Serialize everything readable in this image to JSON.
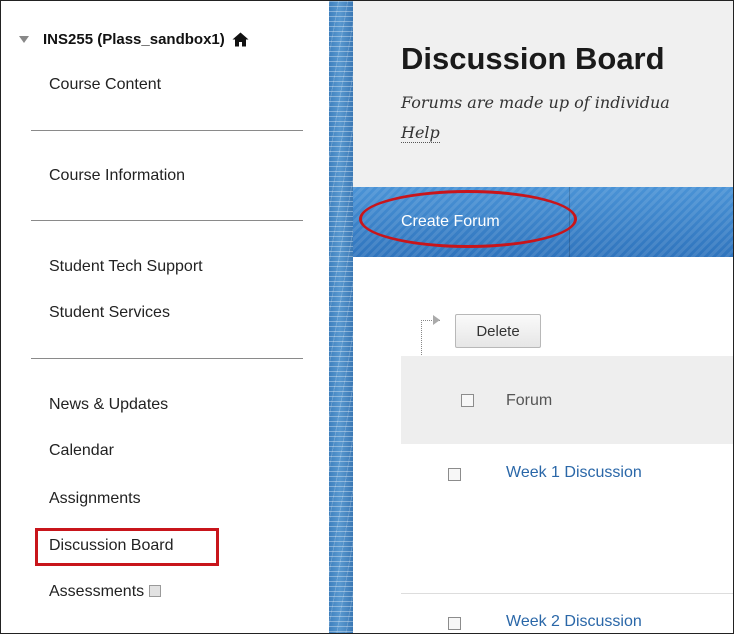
{
  "course": {
    "title": "INS255 (Plass_sandbox1)",
    "home_icon": "home-icon"
  },
  "menu": {
    "course_content": "Course Content",
    "course_information": "Course Information",
    "student_tech_support": "Student Tech Support",
    "student_services": "Student Services",
    "news_updates": "News & Updates",
    "calendar": "Calendar",
    "assignments": "Assignments",
    "discussion_board": "Discussion Board",
    "assessments": "Assessments"
  },
  "page": {
    "title": "Discussion Board",
    "description": "Forums are made up of individua",
    "help": "Help"
  },
  "actionbar": {
    "create_forum": "Create Forum"
  },
  "toolbar": {
    "delete": "Delete"
  },
  "table": {
    "header_forum": "Forum",
    "rows": [
      {
        "title": "Week 1 Discussion"
      },
      {
        "title": "Week 2 Discussion"
      }
    ]
  },
  "colors": {
    "highlight": "#c8151b",
    "link": "#2a67a8",
    "actionbar": "#3a7fc6"
  }
}
